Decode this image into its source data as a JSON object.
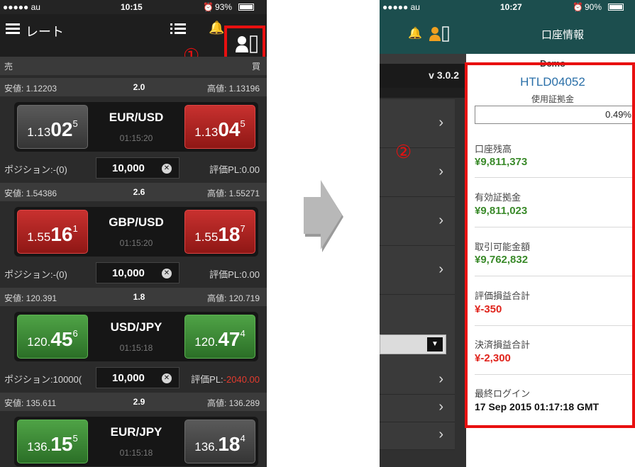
{
  "left_phone": {
    "status": {
      "carrier": "●●●●● au",
      "time": "10:15",
      "battery": "93%"
    },
    "nav": {
      "title": "レート",
      "menu_icon": "hamburger-icon",
      "list_icon": "list-icon",
      "bell_icon": "bell-icon",
      "account_icon": "account-icon"
    },
    "annotation_1": "①",
    "sell_label": "売",
    "buy_label": "買",
    "pairs": [
      {
        "low": "安値: 1.12203",
        "spread": "2.0",
        "high": "高値: 1.13196",
        "name": "EUR/USD",
        "time": "01:15:20",
        "bid": {
          "a": "1.13",
          "b": "02",
          "c": "5"
        },
        "ask": {
          "a": "1.13",
          "b": "04",
          "c": "5"
        },
        "position": "ポジション:-(0)",
        "qty": "10,000",
        "pl_label": "評価PL:",
        "pl_value": "0.00"
      },
      {
        "low": "安値: 1.54386",
        "spread": "2.6",
        "high": "高値: 1.55271",
        "name": "GBP/USD",
        "time": "01:15:20",
        "bid": {
          "a": "1.55",
          "b": "16",
          "c": "1"
        },
        "ask": {
          "a": "1.55",
          "b": "18",
          "c": "7"
        },
        "position": "ポジション:-(0)",
        "qty": "10,000",
        "pl_label": "評価PL:",
        "pl_value": "0.00"
      },
      {
        "low": "安値: 120.391",
        "spread": "1.8",
        "high": "高値: 120.719",
        "name": "USD/JPY",
        "time": "01:15:18",
        "bid": {
          "a": "120.",
          "b": "45",
          "c": "6"
        },
        "ask": {
          "a": "120.",
          "b": "47",
          "c": "4"
        },
        "position": "ポジション:10000(",
        "qty": "10,000",
        "pl_label": "評価PL:",
        "pl_value": "-2040.00"
      },
      {
        "low": "安値: 135.611",
        "spread": "2.9",
        "high": "高値: 136.289",
        "name": "EUR/JPY",
        "time": "01:15:18",
        "bid": {
          "a": "136.",
          "b": "15",
          "c": "5"
        },
        "ask": {
          "a": "136.",
          "b": "18",
          "c": "4"
        }
      }
    ]
  },
  "right_phone": {
    "status": {
      "carrier": "●●●●● au",
      "time": "10:27",
      "battery": "90%"
    },
    "nav": {
      "title": "口座情報",
      "bell_icon": "bell-icon",
      "account_icon": "account-icon"
    },
    "version": "v 3.0.2",
    "annotation_2": "②",
    "account": {
      "mode": "Demo",
      "id": "HTLD04052",
      "margin_used_label": "使用証拠金",
      "margin_used_value": "0.49%",
      "items": [
        {
          "label": "口座残高",
          "value": "¥9,811,373",
          "color": "#3a8a2a"
        },
        {
          "label": "有効証拠金",
          "value": "¥9,811,023",
          "color": "#3a8a2a"
        },
        {
          "label": "取引可能金額",
          "value": "¥9,762,832",
          "color": "#3a8a2a"
        },
        {
          "label": "評価損益合計",
          "value": "¥-350",
          "color": "#e0241c"
        },
        {
          "label": "決済損益合計",
          "value": "¥-2,300",
          "color": "#e0241c"
        },
        {
          "label": "最終ログイン",
          "value": "17 Sep 2015 01:17:18 GMT",
          "color": "#111111"
        }
      ]
    }
  },
  "colors": {
    "red_annotation": "#e81010",
    "teal_nav": "#1c4e4e",
    "profit_green": "#3a8a2a",
    "loss_red": "#e0241c"
  }
}
